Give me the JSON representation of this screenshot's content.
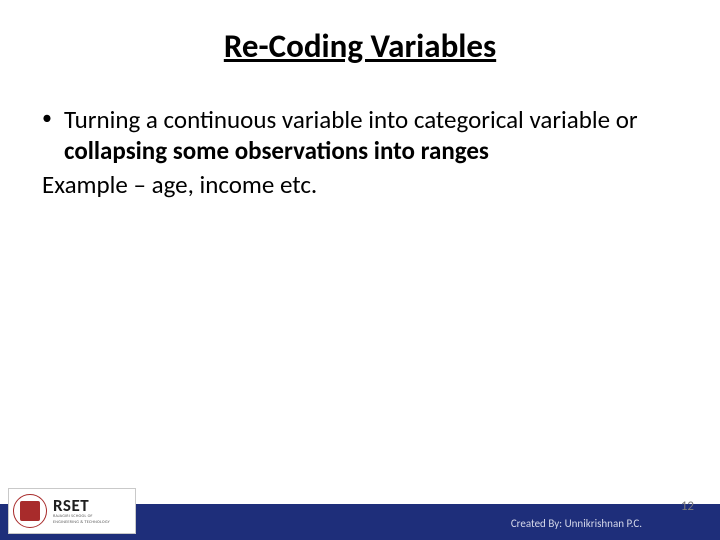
{
  "title": "Re-Coding Variables",
  "bullet": {
    "pre": "Turning a continuous variable into categorical variable or ",
    "bold": "collapsing some observations into ranges"
  },
  "example": "Example – age, income etc.",
  "footer": {
    "logo_main": "RSET",
    "logo_sub1": "RAJAGIRI SCHOOL OF",
    "logo_sub2": "ENGINEERING & TECHNOLOGY",
    "credit": "Created By: Unnikrishnan P.C.",
    "page": "12"
  }
}
